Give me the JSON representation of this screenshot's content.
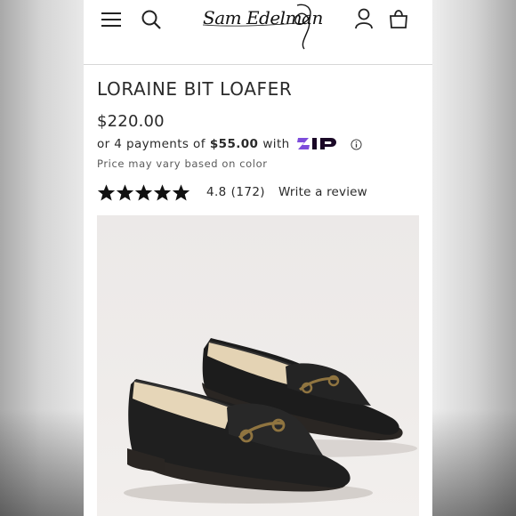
{
  "header": {
    "brand_logo": "Sam Edelman",
    "icons": {
      "menu": "hamburger-menu-icon",
      "search": "search-icon",
      "account": "account-icon",
      "bag": "shopping-bag-icon"
    }
  },
  "product": {
    "title": "LORAINE BIT LOAFER",
    "price": "$220.00",
    "installments": {
      "prefix": "or 4 payments of",
      "amount": "$55.00",
      "suffix": "with",
      "provider": "zip"
    },
    "price_note": "Price may vary based on color",
    "rating": {
      "stars": 4.8,
      "value": "4.8",
      "count": "(172)",
      "write_review": "Write a review"
    }
  },
  "colors": {
    "text": "#2a2a2a",
    "zip_purple": "#7d4cdb",
    "zip_dark": "#1a0826",
    "image_bg": "#ece9e8"
  }
}
